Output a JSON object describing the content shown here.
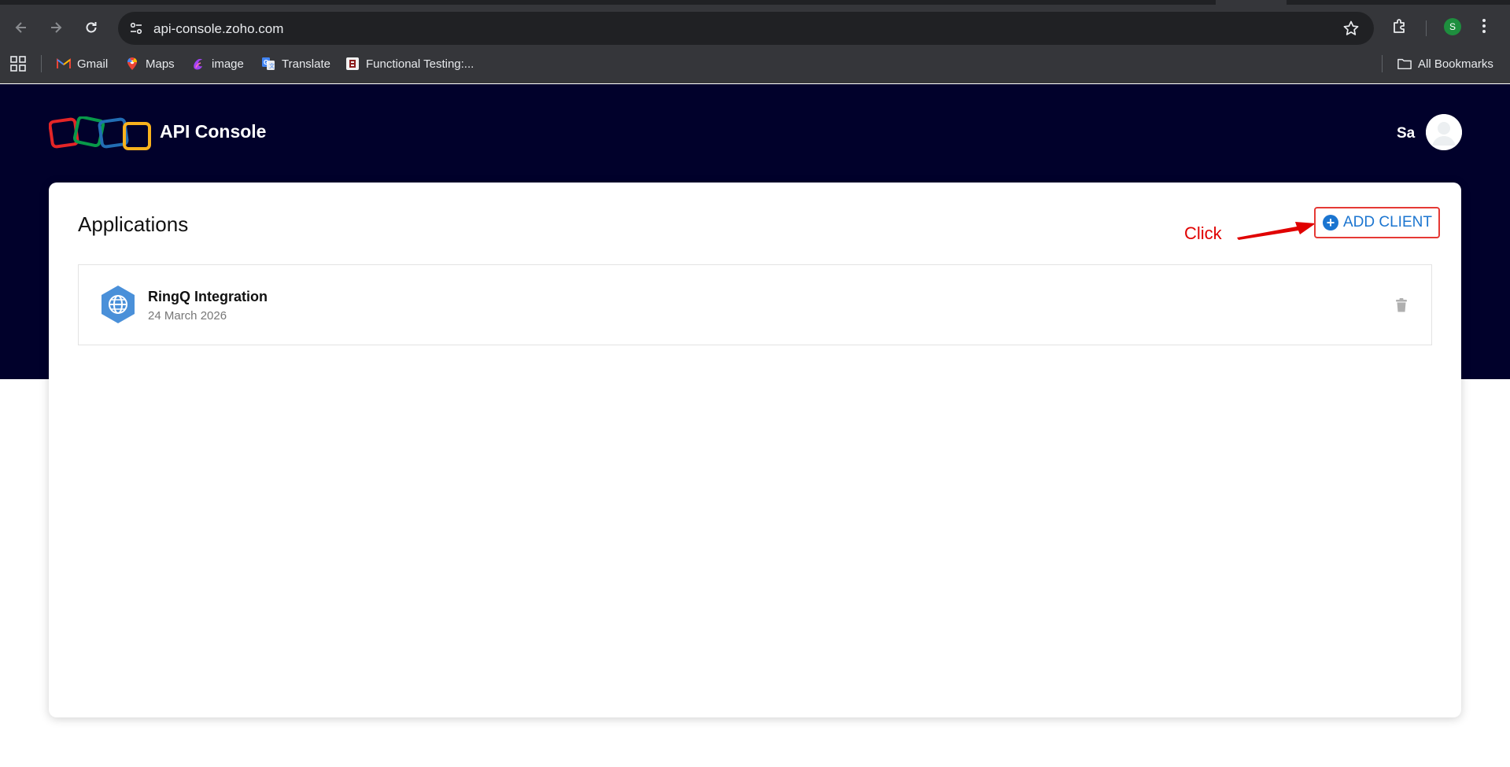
{
  "browser": {
    "url": "api-console.zoho.com",
    "profile_initial": "S",
    "bookmarks": [
      {
        "label": "Gmail",
        "icon": "gmail-icon"
      },
      {
        "label": "Maps",
        "icon": "maps-icon"
      },
      {
        "label": "image",
        "icon": "image-bookmark-icon"
      },
      {
        "label": "Translate",
        "icon": "translate-icon"
      },
      {
        "label": "Functional Testing:...",
        "icon": "functional-testing-icon"
      }
    ],
    "all_bookmarks_label": "All Bookmarks"
  },
  "header": {
    "title": "API Console",
    "user_name": "Sa"
  },
  "main": {
    "title": "Applications",
    "add_client_label": "ADD CLIENT",
    "annotation": "Click",
    "applications": [
      {
        "name": "RingQ Integration",
        "date": "24 March 2026"
      }
    ]
  },
  "colors": {
    "header_bg": "#01012b",
    "accent": "#1b75d0",
    "annotation": "#e00000"
  }
}
